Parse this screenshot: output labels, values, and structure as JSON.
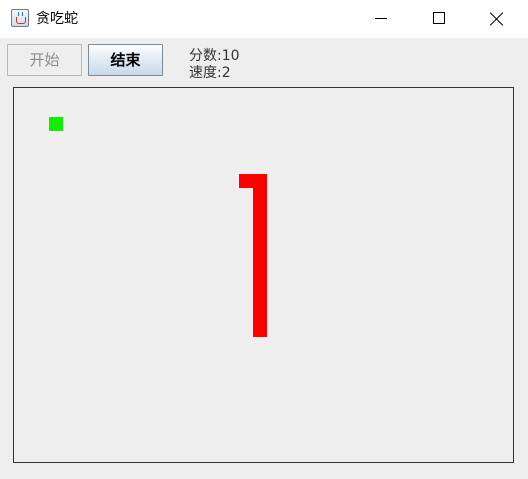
{
  "window": {
    "title": "贪吃蛇"
  },
  "toolbar": {
    "start_label": "开始",
    "end_label": "结束"
  },
  "status": {
    "score_text": "分数:10",
    "speed_text": "速度:2"
  },
  "colors": {
    "food": "#11ee00",
    "snake": "#ff0000",
    "board_bg": "#eeeeee",
    "board_border": "#333333"
  },
  "game": {
    "food": [
      1,
      1
    ],
    "snake": [
      [
        9,
        3
      ],
      [
        9,
        4
      ],
      [
        9,
        5
      ],
      [
        9,
        6
      ],
      [
        9,
        7
      ],
      [
        9,
        8
      ],
      [
        9,
        9
      ],
      [
        9,
        10
      ],
      [
        9,
        11
      ],
      [
        9,
        12
      ],
      [
        9,
        13
      ],
      [
        9,
        14
      ],
      [
        8,
        3
      ]
    ]
  }
}
